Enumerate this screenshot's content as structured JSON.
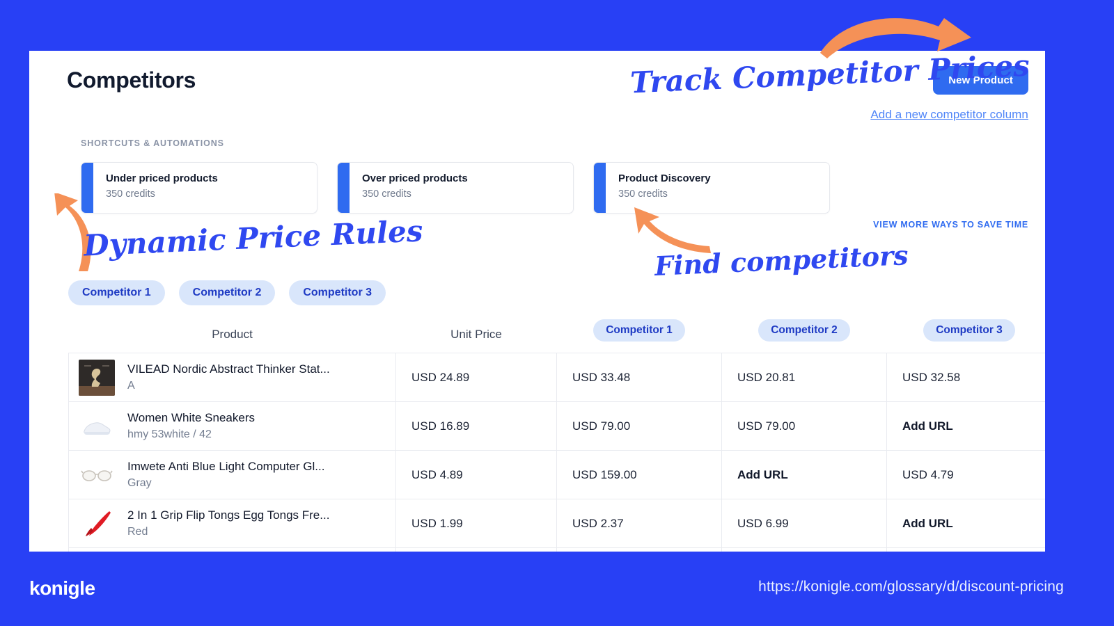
{
  "background_color": "#2840f5",
  "header": {
    "title": "Competitors",
    "new_product_button": "New Product",
    "add_column_link": "Add a new competitor column"
  },
  "shortcuts": {
    "section_label": "SHORTCUTS & AUTOMATIONS",
    "view_more_label": "VIEW MORE WAYS TO SAVE TIME",
    "cards": [
      {
        "title": "Under priced products",
        "subtitle": "350 credits"
      },
      {
        "title": "Over priced products",
        "subtitle": "350 credits"
      },
      {
        "title": "Product Discovery",
        "subtitle": "350 credits"
      }
    ]
  },
  "filter_pills": [
    "Competitor 1",
    "Competitor 2",
    "Competitor 3"
  ],
  "table": {
    "headers": {
      "product": "Product",
      "unit_price": "Unit Price",
      "competitor_1": "Competitor 1",
      "competitor_2": "Competitor 2",
      "competitor_3": "Competitor 3"
    },
    "rows": [
      {
        "name": "VILEAD Nordic Abstract Thinker Stat...",
        "variant": "A",
        "thumb": "statue-thumbnail",
        "unit_price": "USD  24.89",
        "competitor_1": "USD 33.48",
        "competitor_2": "USD 20.81",
        "competitor_3": "USD 32.58"
      },
      {
        "name": "Women White Sneakers",
        "variant": "hmy 53white / 42",
        "thumb": "sneaker-thumbnail",
        "unit_price": "USD  16.89",
        "competitor_1": "USD 79.00",
        "competitor_2": "USD 79.00",
        "competitor_3": "Add URL"
      },
      {
        "name": "Imwete Anti Blue Light Computer Gl...",
        "variant": "Gray",
        "thumb": "glasses-thumbnail",
        "unit_price": "USD  4.89",
        "competitor_1": "USD 159.00",
        "competitor_2": "Add URL",
        "competitor_3": "USD 4.79"
      },
      {
        "name": "2 In 1 Grip Flip Tongs Egg Tongs Fre...",
        "variant": "Red",
        "thumb": "tongs-thumbnail",
        "unit_price": "USD  1.99",
        "competitor_1": "USD 2.37",
        "competitor_2": "USD 6.99",
        "competitor_3": "Add URL"
      }
    ]
  },
  "annotations": {
    "track": "Track Competitor Prices",
    "rules": "Dynamic Price Rules",
    "find": "Find competitors",
    "arrow_color": "#f59157"
  },
  "footer": {
    "logo": "konigle",
    "url": "https://konigle.com/glossary/d/discount-pricing"
  },
  "colors": {
    "brand_blue": "#2840f5",
    "button_blue": "#2f6bf0",
    "pill_bg": "#d9e6fb",
    "pill_text": "#1f3bc4",
    "accent_orange": "#f59157"
  }
}
